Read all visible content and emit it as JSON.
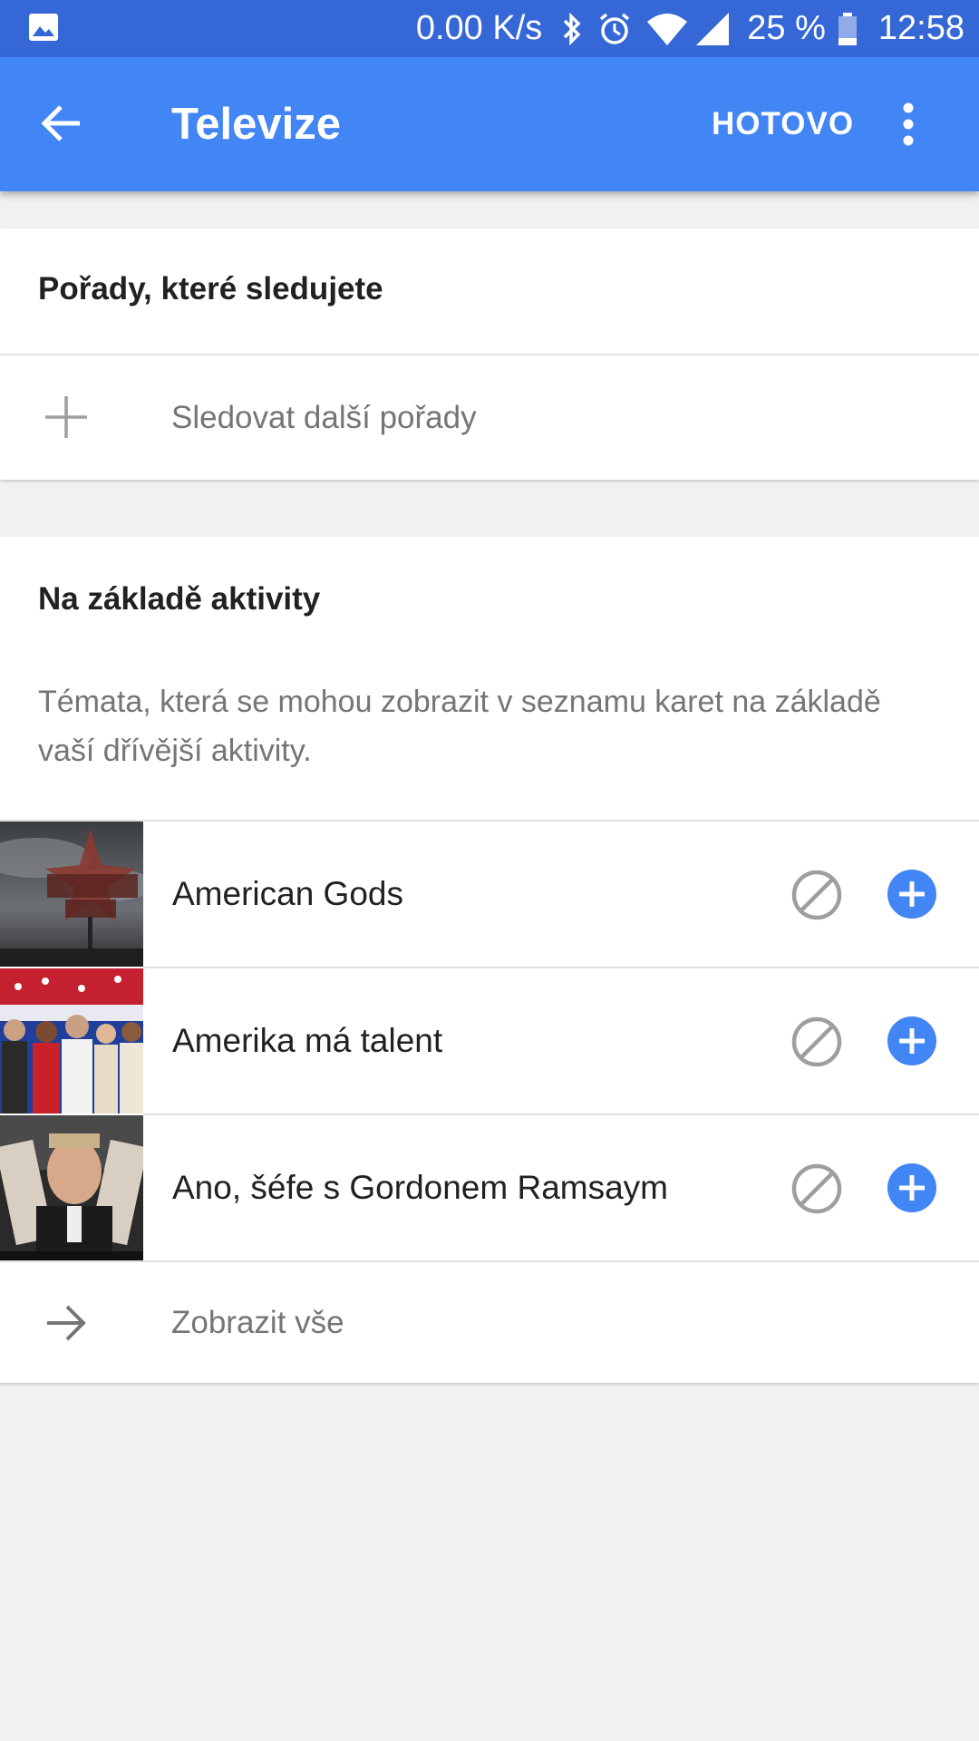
{
  "status_bar": {
    "speed": "0.00 K/s",
    "battery_percent": "25 %",
    "time": "12:58",
    "icons": [
      "gallery-icon",
      "bluetooth-icon",
      "alarm-icon",
      "wifi-icon",
      "signal-icon",
      "battery-icon"
    ]
  },
  "app_bar": {
    "title": "Televize",
    "done_label": "HOTOVO",
    "back_icon": "arrow-back-icon",
    "more_icon": "more-vert-icon",
    "color": "#4285f4"
  },
  "followed_section": {
    "heading": "Pořady, které sledujete",
    "follow_more_label": "Sledovat další pořady"
  },
  "activity_section": {
    "heading": "Na základě aktivity",
    "description": "Témata, která se mohou zobrazit v seznamu karet na základě vaší dřívější aktivity.",
    "shows": [
      {
        "title": "American Gods"
      },
      {
        "title": "Amerika má talent"
      },
      {
        "title": "Ano, šéfe s Gordonem Ramsaym"
      }
    ],
    "show_all_label": "Zobrazit vše",
    "accent_color": "#4285f4"
  }
}
